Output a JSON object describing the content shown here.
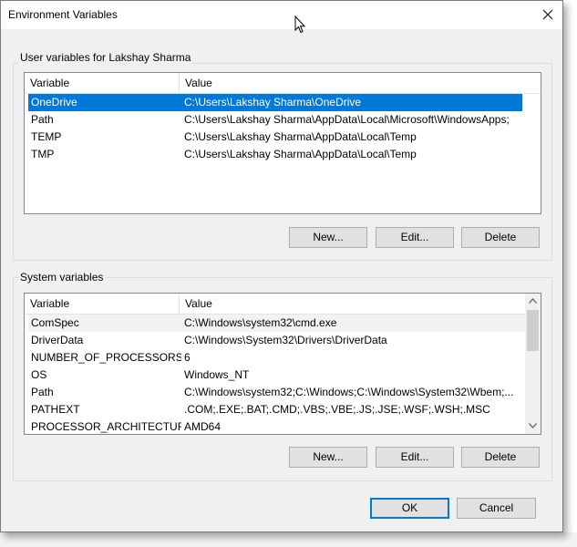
{
  "window": {
    "title": "Environment Variables",
    "close_glyph": "✕"
  },
  "user_vars": {
    "label": "User variables for Lakshay Sharma",
    "headers": {
      "variable": "Variable",
      "value": "Value"
    },
    "rows": [
      {
        "variable": "OneDrive",
        "value": "C:\\Users\\Lakshay Sharma\\OneDrive",
        "selected": true
      },
      {
        "variable": "Path",
        "value": "C:\\Users\\Lakshay Sharma\\AppData\\Local\\Microsoft\\WindowsApps;"
      },
      {
        "variable": "TEMP",
        "value": "C:\\Users\\Lakshay Sharma\\AppData\\Local\\Temp"
      },
      {
        "variable": "TMP",
        "value": "C:\\Users\\Lakshay Sharma\\AppData\\Local\\Temp"
      }
    ],
    "buttons": {
      "new": "New...",
      "edit": "Edit...",
      "delete": "Delete"
    }
  },
  "system_vars": {
    "label": "System variables",
    "headers": {
      "variable": "Variable",
      "value": "Value"
    },
    "rows": [
      {
        "variable": "ComSpec",
        "value": "C:\\Windows\\system32\\cmd.exe",
        "hot": true
      },
      {
        "variable": "DriverData",
        "value": "C:\\Windows\\System32\\Drivers\\DriverData"
      },
      {
        "variable": "NUMBER_OF_PROCESSORS",
        "value": "6"
      },
      {
        "variable": "OS",
        "value": "Windows_NT"
      },
      {
        "variable": "Path",
        "value": "C:\\Windows\\system32;C:\\Windows;C:\\Windows\\System32\\Wbem;..."
      },
      {
        "variable": "PATHEXT",
        "value": ".COM;.EXE;.BAT;.CMD;.VBS;.VBE;.JS;.JSE;.WSF;.WSH;.MSC"
      },
      {
        "variable": "PROCESSOR_ARCHITECTURE",
        "value": "AMD64"
      }
    ],
    "buttons": {
      "new": "New...",
      "edit": "Edit...",
      "delete": "Delete"
    }
  },
  "footer": {
    "ok": "OK",
    "cancel": "Cancel"
  },
  "icons": {
    "close": "close-icon",
    "cursor": "mouse-pointer-icon",
    "scroll_up": "chevron-up-icon",
    "scroll_down": "chevron-down-icon"
  },
  "colors": {
    "selection": "#0078d7",
    "default_button_border": "#0078d7",
    "dialog_bg": "#f0f0f0"
  }
}
